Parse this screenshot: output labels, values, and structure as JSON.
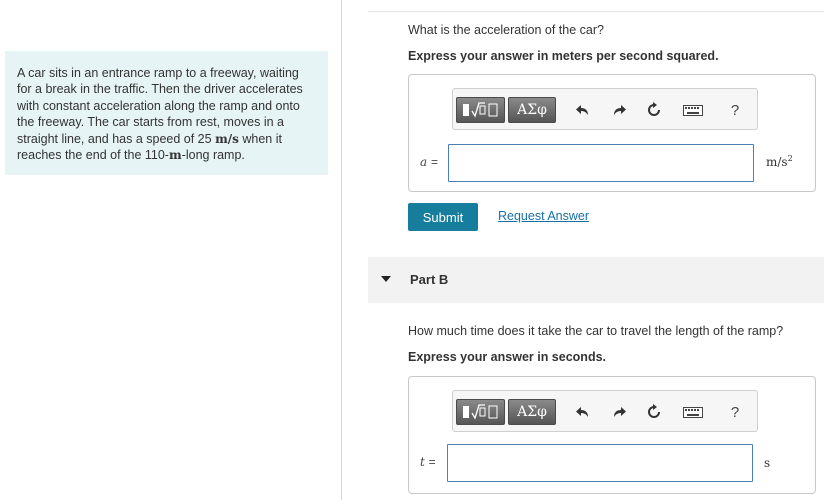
{
  "problem": {
    "lines": [
      "A car sits in an entrance ramp to a freeway, waiting",
      "for a break in the traffic. Then the driver accelerates",
      "with constant acceleration along the ramp and onto",
      "the freeway. The car starts from rest, moves in a",
      "straight line, and has a speed of 25 ",
      " when it",
      "reaches the end of the 110-",
      "-long ramp."
    ],
    "speed_unit": "m/s",
    "length_unit": "m"
  },
  "partA": {
    "question": "What is the acceleration of the car?",
    "instruction": "Express your answer in meters per second squared.",
    "variable": "a",
    "equals": "=",
    "answer_value": "",
    "unit_base": "m/s",
    "unit_exp": "2",
    "submit_label": "Submit",
    "request_label": "Request Answer"
  },
  "toolbar": {
    "symbol_label": "ΑΣφ",
    "undo_icon": "undo-icon",
    "redo_icon": "redo-icon",
    "reset_icon": "reset-icon",
    "keyboard_icon": "keyboard-icon",
    "help_label": "?"
  },
  "partB": {
    "title": "Part B",
    "question": "How much time does it take the car to travel the length of the ramp?",
    "instruction": "Express your answer in seconds.",
    "variable": "t",
    "equals": "=",
    "answer_value": "",
    "unit": "s"
  },
  "colors": {
    "submit_bg": "#167d9c",
    "link": "#1a6fa8",
    "problem_bg": "#e6f4f6",
    "input_border": "#4b7fb5"
  }
}
